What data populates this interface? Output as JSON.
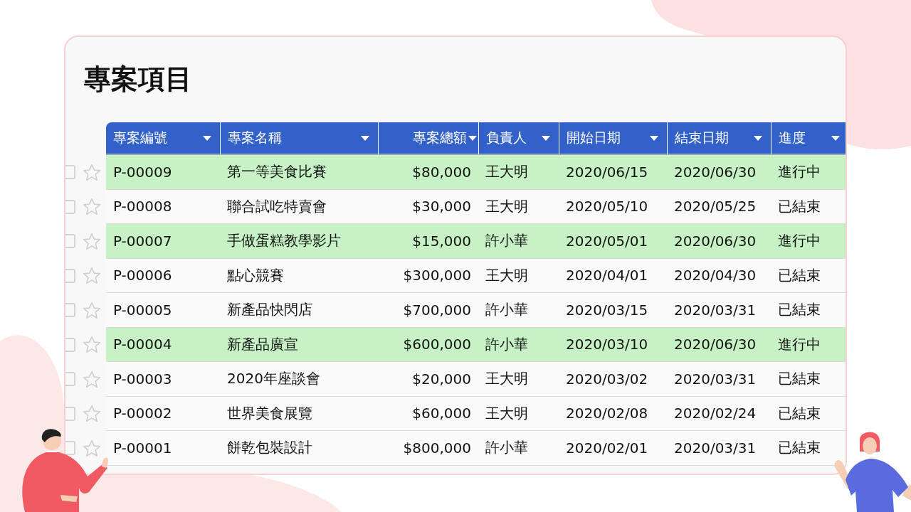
{
  "title": "專案項目",
  "table": {
    "columns": [
      {
        "label": "專案編號"
      },
      {
        "label": "專案名稱"
      },
      {
        "label": "專案總額"
      },
      {
        "label": "負責人"
      },
      {
        "label": "開始日期"
      },
      {
        "label": "結束日期"
      },
      {
        "label": "進度"
      }
    ],
    "rows": [
      {
        "checked": false,
        "starred": false,
        "highlighted": true,
        "cells": [
          "P-00009",
          "第一等美食比賽",
          "$80,000",
          "王大明",
          "2020/06/15",
          "2020/06/30",
          "進行中"
        ]
      },
      {
        "checked": false,
        "starred": false,
        "highlighted": false,
        "cells": [
          "P-00008",
          "聯合試吃特賣會",
          "$30,000",
          "王大明",
          "2020/05/10",
          "2020/05/25",
          "已結束"
        ]
      },
      {
        "checked": false,
        "starred": false,
        "highlighted": true,
        "cells": [
          "P-00007",
          "手做蛋糕教學影片",
          "$15,000",
          "許小華",
          "2020/05/01",
          "2020/06/30",
          "進行中"
        ]
      },
      {
        "checked": false,
        "starred": false,
        "highlighted": false,
        "cells": [
          "P-00006",
          "點心競賽",
          "$300,000",
          "王大明",
          "2020/04/01",
          "2020/04/30",
          "已結束"
        ]
      },
      {
        "checked": false,
        "starred": false,
        "highlighted": false,
        "cells": [
          "P-00005",
          "新產品快閃店",
          "$700,000",
          "許小華",
          "2020/03/15",
          "2020/03/31",
          "已結束"
        ]
      },
      {
        "checked": false,
        "starred": false,
        "highlighted": true,
        "cells": [
          "P-00004",
          "新產品廣宣",
          "$600,000",
          "許小華",
          "2020/03/10",
          "2020/06/30",
          "進行中"
        ]
      },
      {
        "checked": false,
        "starred": false,
        "highlighted": false,
        "cells": [
          "P-00003",
          "2020年座談會",
          "$20,000",
          "王大明",
          "2020/03/02",
          "2020/03/31",
          "已結束"
        ]
      },
      {
        "checked": false,
        "starred": false,
        "highlighted": false,
        "cells": [
          "P-00002",
          "世界美食展覽",
          "$60,000",
          "王大明",
          "2020/02/08",
          "2020/02/24",
          "已結束"
        ]
      },
      {
        "checked": false,
        "starred": false,
        "highlighted": false,
        "cells": [
          "P-00001",
          "餅乾包裝設計",
          "$800,000",
          "許小華",
          "2020/02/01",
          "2020/03/31",
          "已結束"
        ]
      }
    ]
  }
}
